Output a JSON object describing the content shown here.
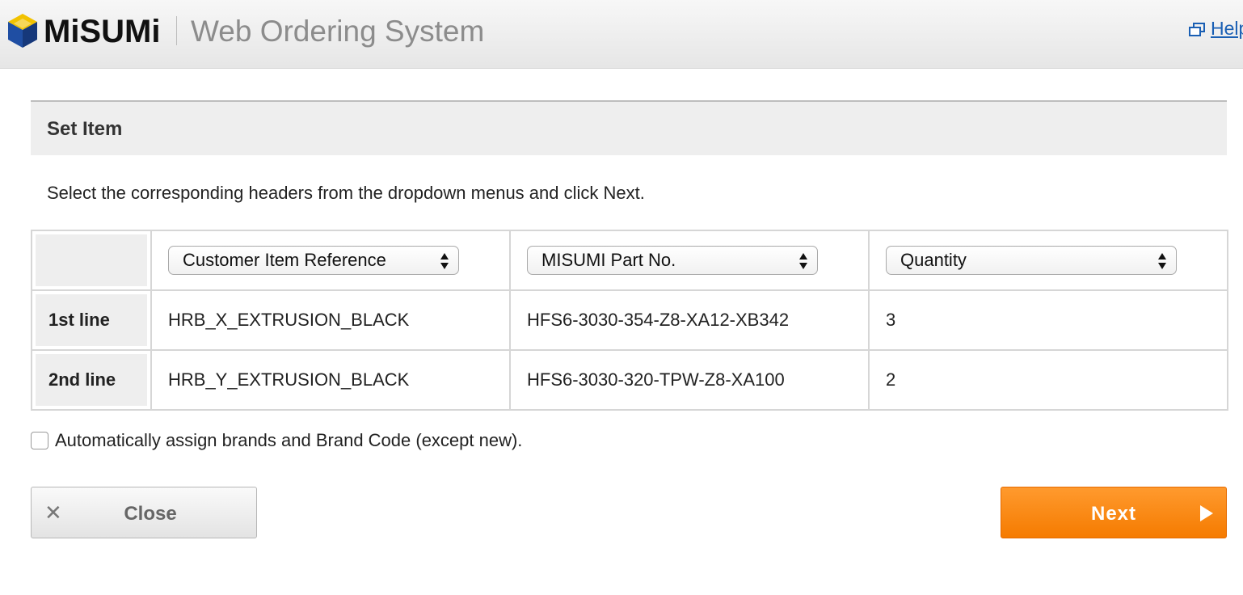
{
  "header": {
    "brand": "MiSUMi",
    "system_name": "Web Ordering System",
    "help_label": "Help",
    "icons": {
      "logo": "misumi-cube-logo",
      "help": "external-window-icon"
    }
  },
  "section": {
    "title": "Set Item",
    "instruction": "Select the corresponding headers from the dropdown menus and click Next."
  },
  "columns": [
    {
      "selected": "Customer Item Reference"
    },
    {
      "selected": "MISUMI Part No."
    },
    {
      "selected": "Quantity"
    }
  ],
  "rows": [
    {
      "label": "1st line",
      "cells": [
        "HRB_X_EXTRUSION_BLACK",
        "HFS6-3030-354-Z8-XA12-XB342",
        "3"
      ]
    },
    {
      "label": "2nd line",
      "cells": [
        "HRB_Y_EXTRUSION_BLACK",
        "HFS6-3030-320-TPW-Z8-XA100",
        "2"
      ]
    }
  ],
  "auto_assign": {
    "label": "Automatically assign brands and Brand Code (except new).",
    "checked": false
  },
  "buttons": {
    "close": "Close",
    "next": "Next"
  },
  "colors": {
    "accent": "#f57b00",
    "link": "#1a5fb4",
    "logo_blue": "#1f4ea3",
    "logo_yellow": "#f2c200"
  }
}
